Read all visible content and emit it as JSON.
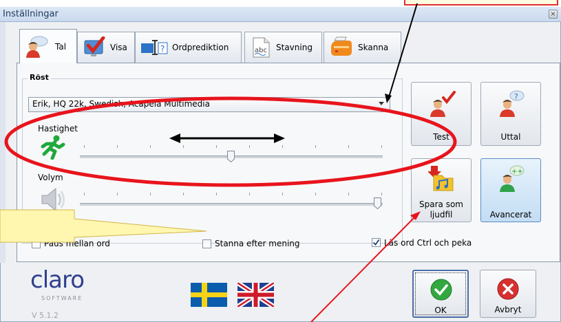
{
  "window": {
    "title": "Inställningar",
    "close_glyph": "×"
  },
  "tabs": [
    {
      "label": "Tal",
      "icon": "speaking-person-icon",
      "active": true
    },
    {
      "label": "Visa",
      "icon": "monitor-checkmark-icon",
      "active": false
    },
    {
      "label": "Ordprediktion",
      "icon": "word-prediction-icon",
      "active": false
    },
    {
      "label": "Stavning",
      "icon": "spelling-abc-icon",
      "active": false
    },
    {
      "label": "Skanna",
      "icon": "scanner-icon",
      "active": false
    }
  ],
  "voice_group": {
    "label": "Röst",
    "voice_select": {
      "value": "Erik, HQ 22k, Swedish, Acapela Multimedia"
    },
    "speed": {
      "label": "Hastighet",
      "value_fraction": 0.49
    },
    "volume": {
      "label": "Volym",
      "value_fraction": 1.0
    }
  },
  "side_buttons": {
    "test": "Test",
    "pronunciation": "Uttal",
    "save_audio_line1": "Spara som",
    "save_audio_line2": "ljudfil",
    "advanced": "Avancerat"
  },
  "checkboxes": [
    {
      "label": "Paus mellan ord",
      "checked": false
    },
    {
      "label": "Stanna efter mening",
      "checked": false
    },
    {
      "label": "Läs ord Ctrl och peka",
      "checked": true
    }
  ],
  "branding": {
    "logo_text": "claro",
    "logo_subtext": "SOFTWARE",
    "version": "V 5.1.2"
  },
  "languages": [
    "swedish-flag-icon",
    "uk-flag-icon"
  ],
  "dialog_buttons": {
    "ok": "OK",
    "cancel": "Avbryt"
  },
  "colors": {
    "annotation_red": "#e8141c",
    "callout_yellow": "#fff7b0",
    "selection_blue": "#c3ddf4",
    "ok_green": "#2f9a3a",
    "cancel_red": "#d42b2b"
  }
}
